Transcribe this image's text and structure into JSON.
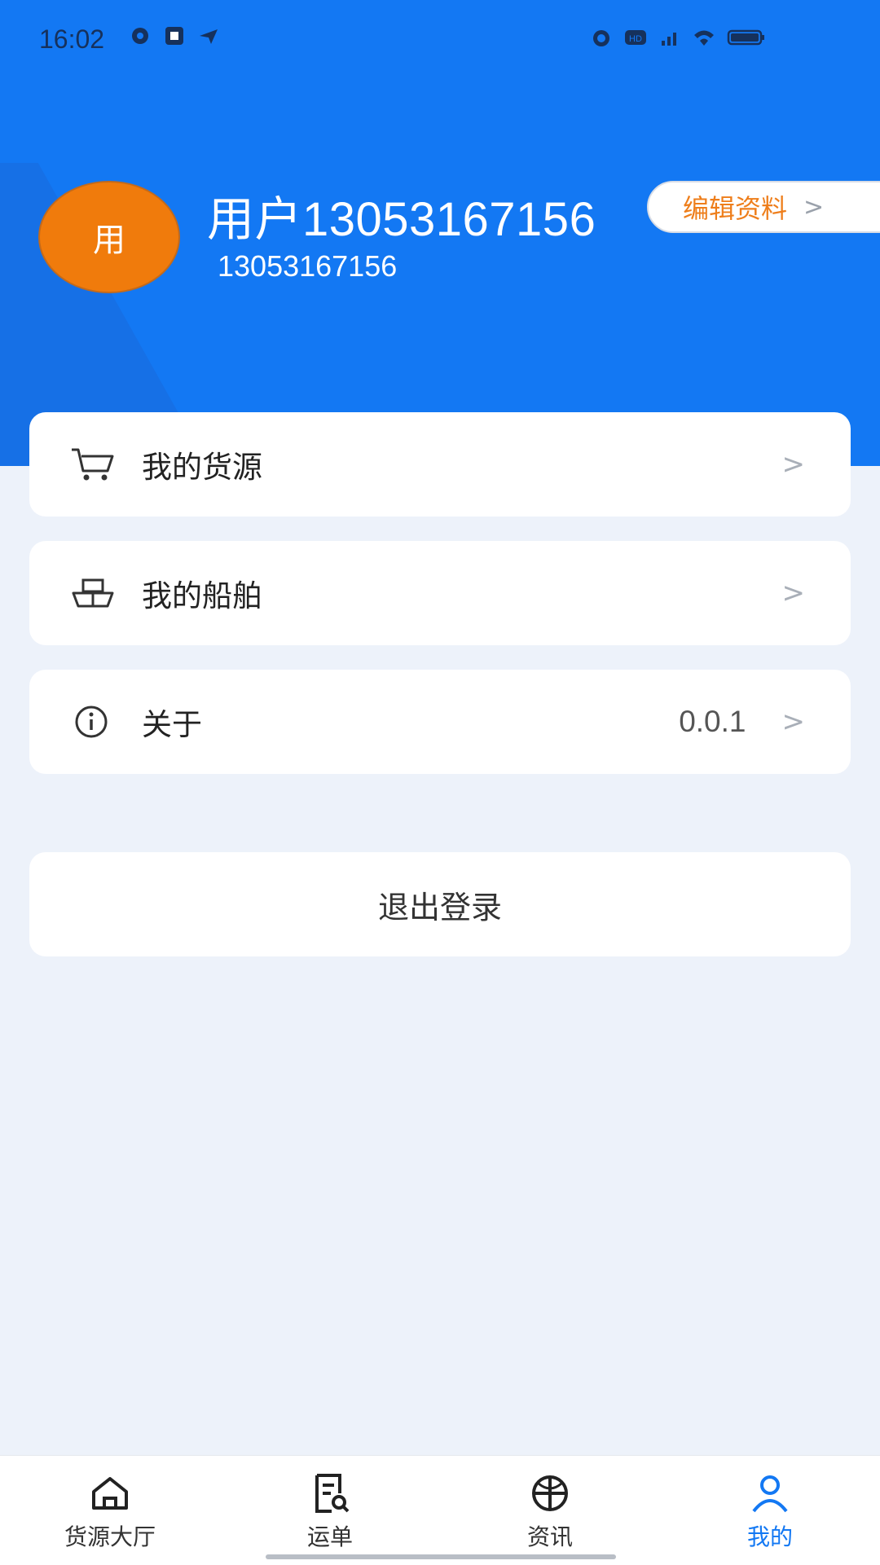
{
  "status_bar": {
    "time": "16:02",
    "left_icons": [
      "notification-icon",
      "app-icon",
      "network-arrow-icon"
    ],
    "right_icons": [
      "alarm-icon",
      "hd-icon",
      "signal-icon",
      "wifi-icon",
      "battery-icon"
    ]
  },
  "profile": {
    "avatar_text": "用",
    "name": "用户13053167156",
    "phone": "13053167156",
    "edit_label": "编辑资料",
    "accent_color": "#1378f3",
    "avatar_color": "#f07b0c"
  },
  "menu": {
    "items": [
      {
        "label": "我的货源",
        "icon": "cart-icon",
        "value": ""
      },
      {
        "label": "我的船舶",
        "icon": "ship-icon",
        "value": ""
      },
      {
        "label": "关于",
        "icon": "info-icon",
        "value": "0.0.1"
      }
    ],
    "chevron": ">"
  },
  "logout": {
    "label": "退出登录"
  },
  "tabbar": {
    "tabs": [
      {
        "label": "货源大厅",
        "icon": "home-icon",
        "active": false
      },
      {
        "label": "运单",
        "icon": "waybill-icon",
        "active": false
      },
      {
        "label": "资讯",
        "icon": "news-icon",
        "active": false
      },
      {
        "label": "我的",
        "icon": "profile-icon",
        "active": true
      }
    ]
  }
}
